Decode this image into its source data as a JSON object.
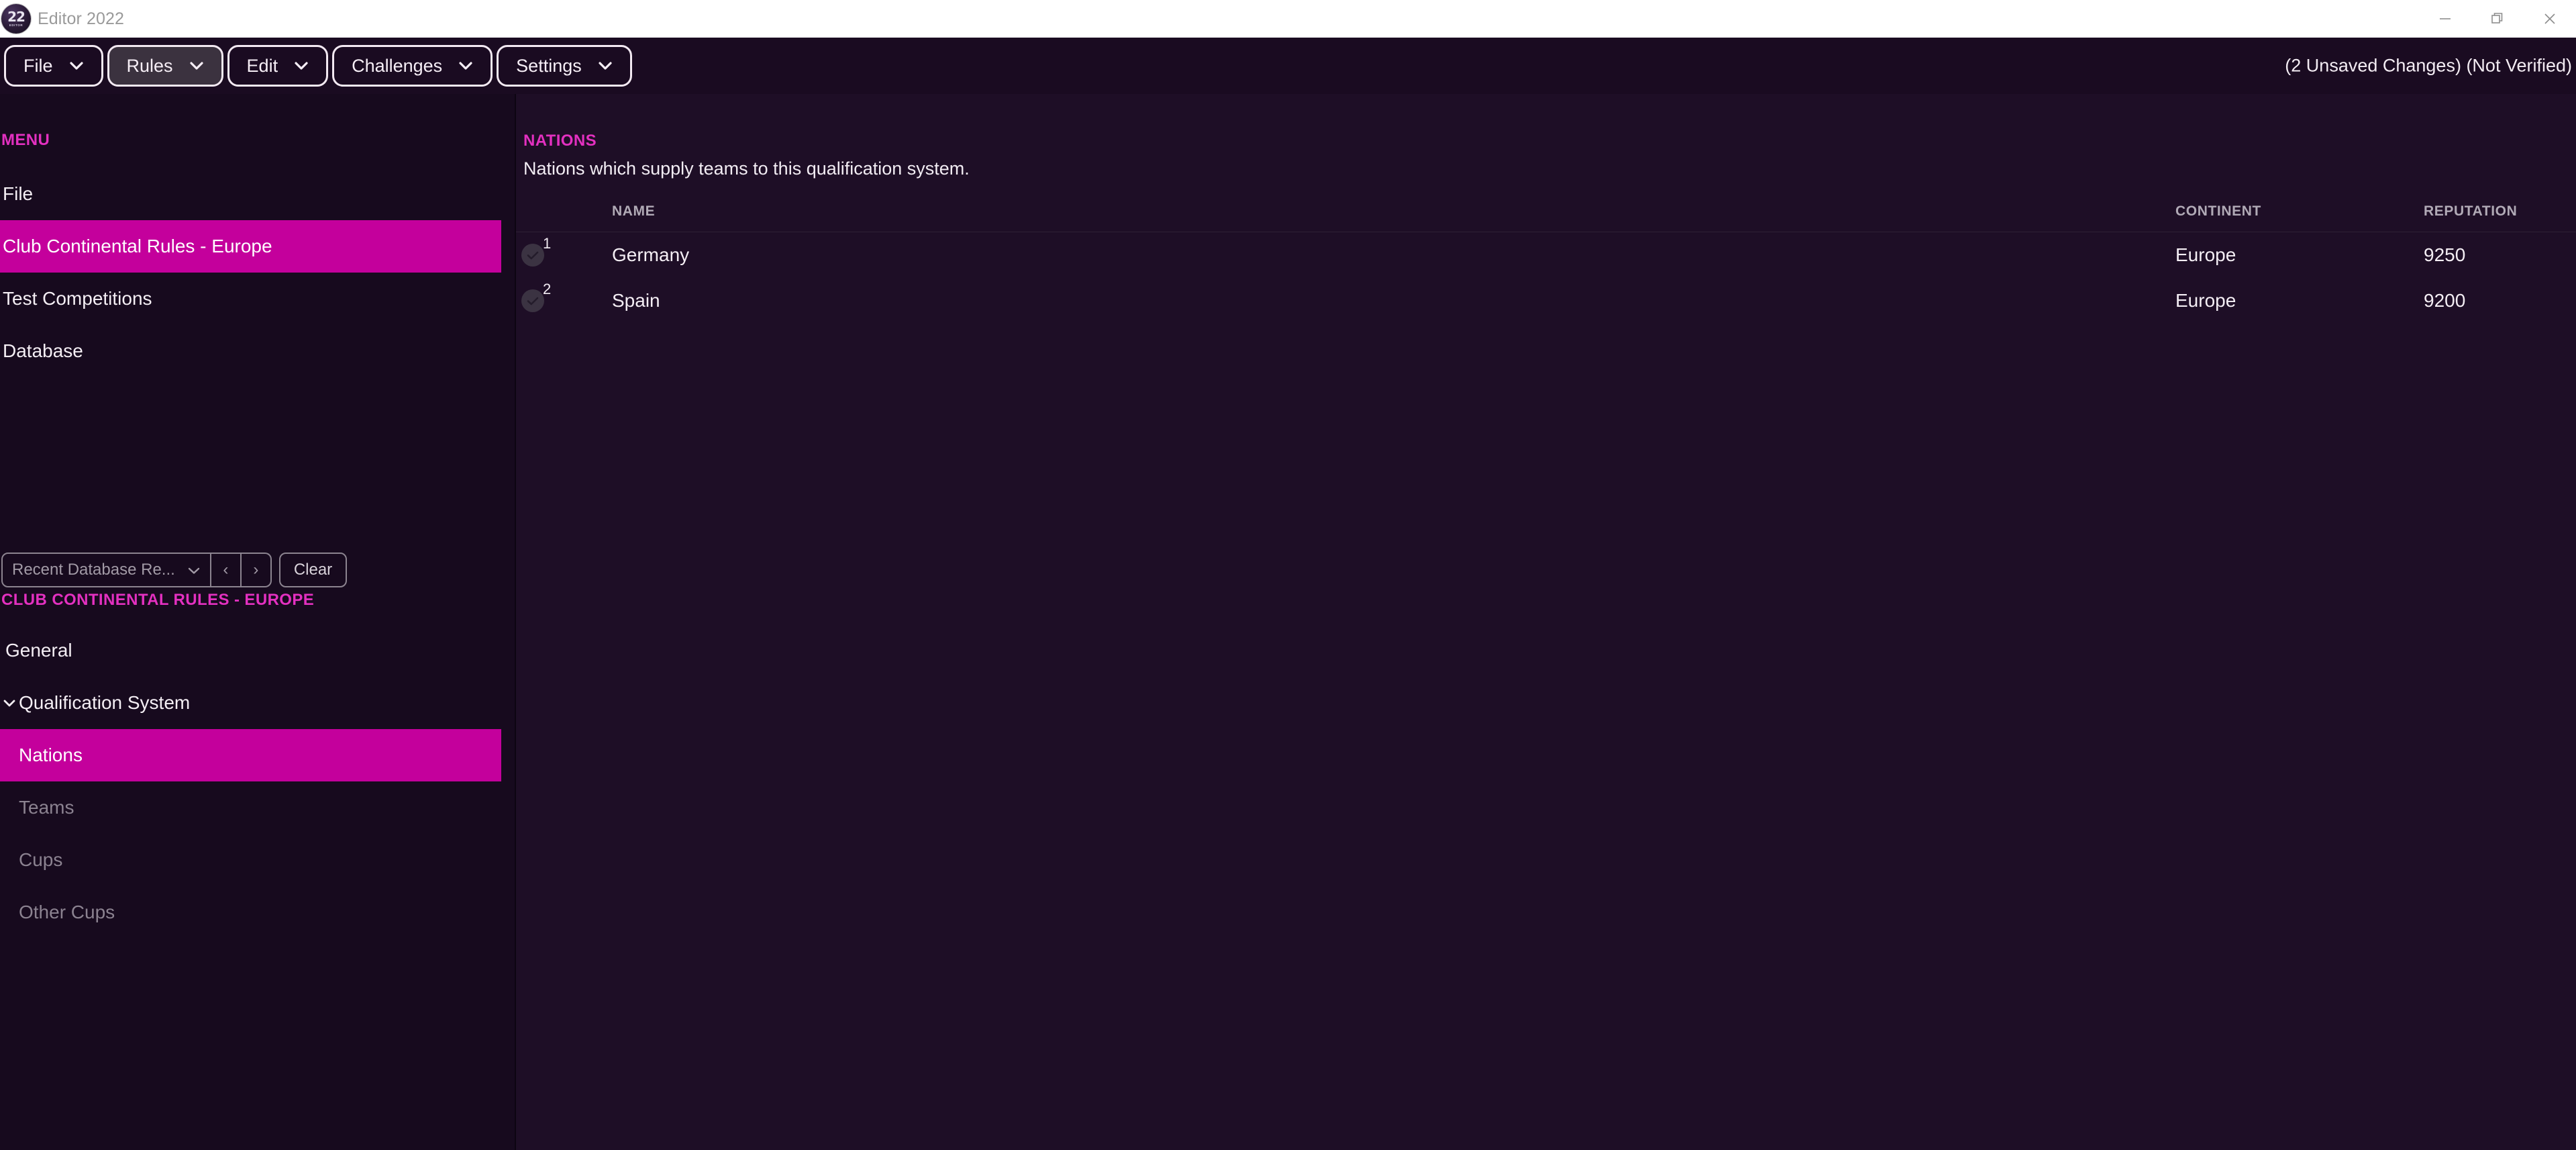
{
  "window": {
    "title": "Editor 2022",
    "logo_number": "22",
    "logo_subtitle": "EDITOR",
    "controls": {
      "minimize": "minimize-icon",
      "restore": "restore-icon",
      "close": "close-icon"
    }
  },
  "menubar": {
    "buttons": [
      {
        "label": "File",
        "active": false
      },
      {
        "label": "Rules",
        "active": true
      },
      {
        "label": "Edit",
        "active": false
      },
      {
        "label": "Challenges",
        "active": false
      },
      {
        "label": "Settings",
        "active": false
      }
    ],
    "status": "(2 Unsaved Changes) (Not Verified)"
  },
  "sidebar": {
    "menu_heading": "MENU",
    "menu_items": [
      {
        "label": "File",
        "selected": false
      },
      {
        "label": "Club Continental Rules - Europe",
        "selected": true
      },
      {
        "label": "Test Competitions",
        "selected": false
      },
      {
        "label": "Database",
        "selected": false
      }
    ],
    "recent": {
      "select_value": "Recent Database Re...",
      "prev_label": "‹",
      "next_label": "›",
      "clear_label": "Clear"
    },
    "rules_heading": "CLUB CONTINENTAL RULES - EUROPE",
    "tree": [
      {
        "label": "General",
        "level": 1,
        "selected": false,
        "dim": false,
        "parent": false
      },
      {
        "label": "Qualification System",
        "level": 1,
        "selected": false,
        "dim": false,
        "parent": true
      },
      {
        "label": "Nations",
        "level": 2,
        "selected": true,
        "dim": false,
        "parent": false
      },
      {
        "label": "Teams",
        "level": 2,
        "selected": false,
        "dim": true,
        "parent": false
      },
      {
        "label": "Cups",
        "level": 2,
        "selected": false,
        "dim": true,
        "parent": false
      },
      {
        "label": "Other Cups",
        "level": 2,
        "selected": false,
        "dim": true,
        "parent": false
      }
    ]
  },
  "main": {
    "title": "NATIONS",
    "description": "Nations which supply teams to this qualification system.",
    "table": {
      "columns": [
        "NAME",
        "CONTINENT",
        "REPUTATION"
      ],
      "rows": [
        {
          "index": "1",
          "name": "Germany",
          "continent": "Europe",
          "reputation": "9250"
        },
        {
          "index": "2",
          "name": "Spain",
          "continent": "Europe",
          "reputation": "9200"
        }
      ]
    }
  },
  "colors": {
    "accent_magenta": "#c4009c",
    "heading_magenta": "#e330c0",
    "background": "#1e0e26",
    "sidebar_background": "#170a1e",
    "titlebar_background": "#ffffff"
  }
}
